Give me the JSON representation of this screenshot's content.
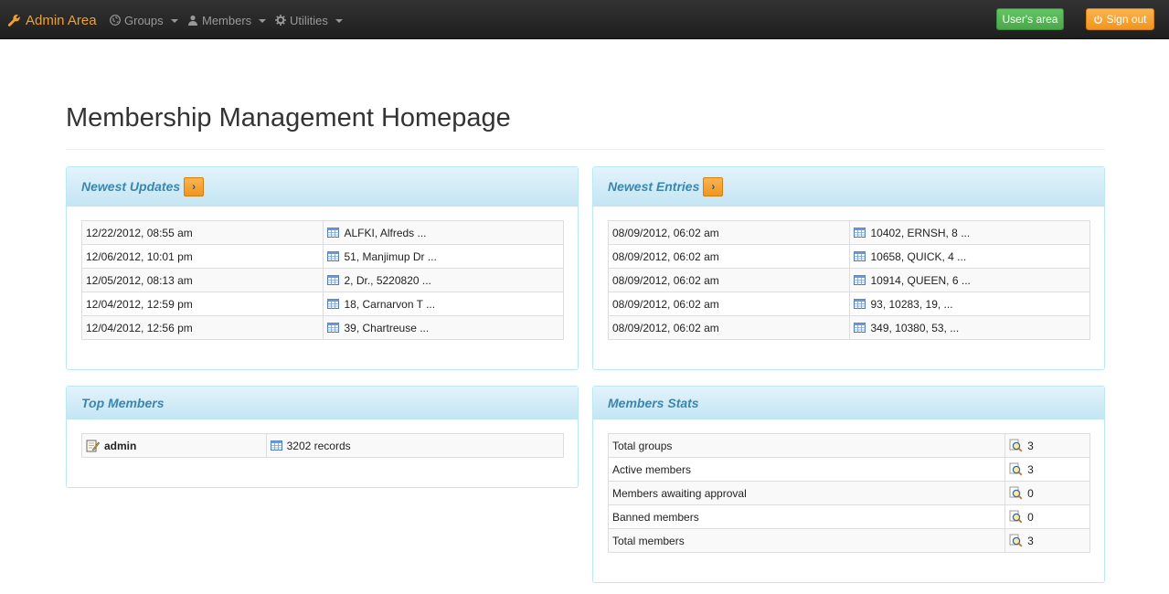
{
  "navbar": {
    "brand": "Admin Area",
    "menus": [
      {
        "label": "Groups"
      },
      {
        "label": "Members"
      },
      {
        "label": "Utilities"
      }
    ],
    "users_area": "User's area",
    "sign_out": "Sign out"
  },
  "page": {
    "title": "Membership Management Homepage"
  },
  "newest_updates": {
    "title": "Newest Updates",
    "rows": [
      {
        "date": "12/22/2012, 08:55 am",
        "record": "ALFKI, Alfreds ..."
      },
      {
        "date": "12/06/2012, 10:01 pm",
        "record": "51, Manjimup Dr ..."
      },
      {
        "date": "12/05/2012, 08:13 am",
        "record": "2, Dr., 5220820 ..."
      },
      {
        "date": "12/04/2012, 12:59 pm",
        "record": "18, Carnarvon T ..."
      },
      {
        "date": "12/04/2012, 12:56 pm",
        "record": "39, Chartreuse ..."
      }
    ]
  },
  "newest_entries": {
    "title": "Newest Entries",
    "rows": [
      {
        "date": "08/09/2012, 06:02 am",
        "record": "10402, ERNSH, 8 ..."
      },
      {
        "date": "08/09/2012, 06:02 am",
        "record": "10658, QUICK, 4 ..."
      },
      {
        "date": "08/09/2012, 06:02 am",
        "record": "10914, QUEEN, 6 ..."
      },
      {
        "date": "08/09/2012, 06:02 am",
        "record": "93, 10283, 19, ..."
      },
      {
        "date": "08/09/2012, 06:02 am",
        "record": "349, 10380, 53, ..."
      }
    ]
  },
  "top_members": {
    "title": "Top Members",
    "rows": [
      {
        "member": "admin",
        "records": "3202 records"
      }
    ]
  },
  "members_stats": {
    "title": "Members Stats",
    "rows": [
      {
        "label": "Total groups",
        "value": "3"
      },
      {
        "label": "Active members",
        "value": "3"
      },
      {
        "label": "Members awaiting approval",
        "value": "0"
      },
      {
        "label": "Banned members",
        "value": "0"
      },
      {
        "label": "Total members",
        "value": "3"
      }
    ]
  },
  "colors": {
    "brand": "#f0a030",
    "panel_title": "#3a87ad",
    "success": "#5bb75b",
    "warning": "#faa732"
  }
}
